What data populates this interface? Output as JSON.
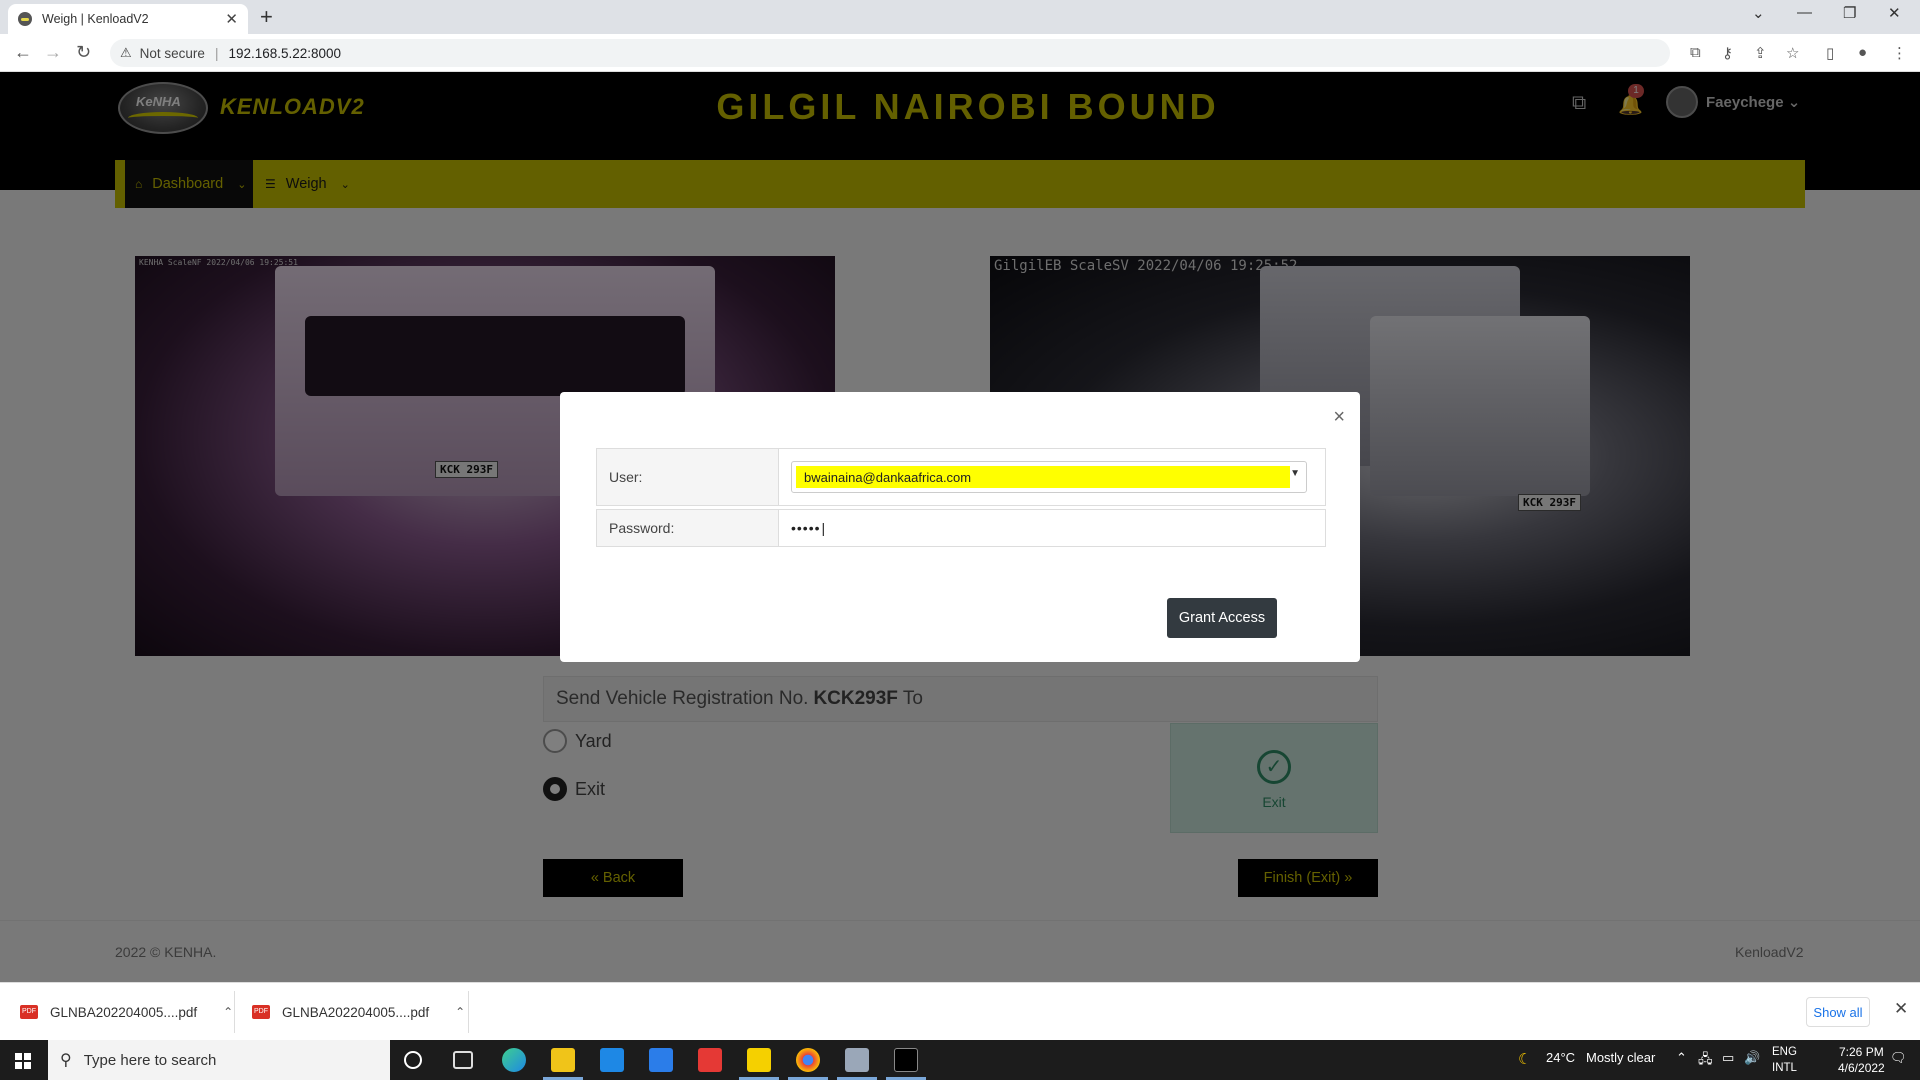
{
  "browser": {
    "tab_title": "Weigh | KenloadV2",
    "tab_close": "✕",
    "new_tab": "+",
    "security": "Not secure",
    "url": "192.168.5.22:8000",
    "window_controls": [
      "⌄",
      "—",
      "❐",
      "✕"
    ]
  },
  "header": {
    "logo_text": "KeNHA",
    "brand": "KENLOADV2",
    "station": "GILGIL NAIROBI BOUND",
    "notification_count": "1",
    "user": "Faeychege"
  },
  "menu": [
    {
      "label": "Dashboard",
      "icon": "home-icon"
    },
    {
      "label": "Weigh",
      "icon": "list-icon"
    }
  ],
  "cameras": {
    "left_stamp": "KENHA ScaleNF 2022/04/06 19:25:51",
    "left_plate": "KCK 293F",
    "right_stamp": "GilgilEB  ScaleSV  2022/04/06  19:25:52",
    "right_plate": "KCK 293F"
  },
  "send": {
    "prefix": "Send Vehicle Registration No.",
    "reg": "KCK293F",
    "suffix": "To",
    "options": [
      {
        "label": "Yard",
        "checked": false
      },
      {
        "label": "Exit",
        "checked": true
      }
    ],
    "card_label": "Exit"
  },
  "buttons": {
    "back": "«  Back",
    "finish": "Finish (Exit)  »"
  },
  "footer": {
    "copyright": "2022 © KENHA.",
    "app": "KenloadV2"
  },
  "modal": {
    "close": "×",
    "user_label": "User:",
    "user_value": "bwainaina@dankaafrica.com",
    "password_label": "Password:",
    "password_value": "•••••",
    "grant": "Grant Access"
  },
  "downloads": {
    "items": [
      "GLNBA202204005....pdf",
      "GLNBA202204005....pdf"
    ],
    "show_all": "Show all"
  },
  "taskbar": {
    "search_placeholder": "Type here to search",
    "weather_temp": "24°C",
    "weather_desc": "Mostly clear",
    "lang_1": "ENG",
    "lang_2": "INTL",
    "time": "7:26 PM",
    "date": "4/6/2022"
  }
}
